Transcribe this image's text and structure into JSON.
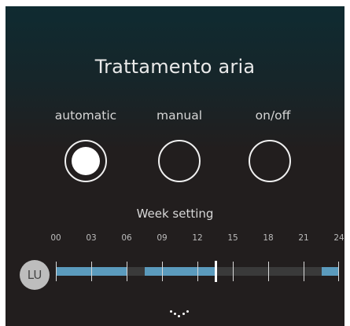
{
  "title": "Trattamento aria",
  "modes": [
    {
      "label": "automatic",
      "selected": true
    },
    {
      "label": "manual",
      "selected": false
    },
    {
      "label": "on/off",
      "selected": false
    }
  ],
  "week": {
    "label": "Week setting",
    "hours": [
      "00",
      "03",
      "06",
      "09",
      "12",
      "15",
      "18",
      "21",
      "24"
    ],
    "day": "LU",
    "active_periods": [
      [
        0,
        6
      ],
      [
        7.5,
        13.5
      ],
      [
        22.5,
        24
      ]
    ],
    "current_hour": 13.5
  },
  "colors": {
    "active": "#5b9bbd",
    "inactive": "#3a3a3a"
  },
  "more_icon": "dots-icon"
}
